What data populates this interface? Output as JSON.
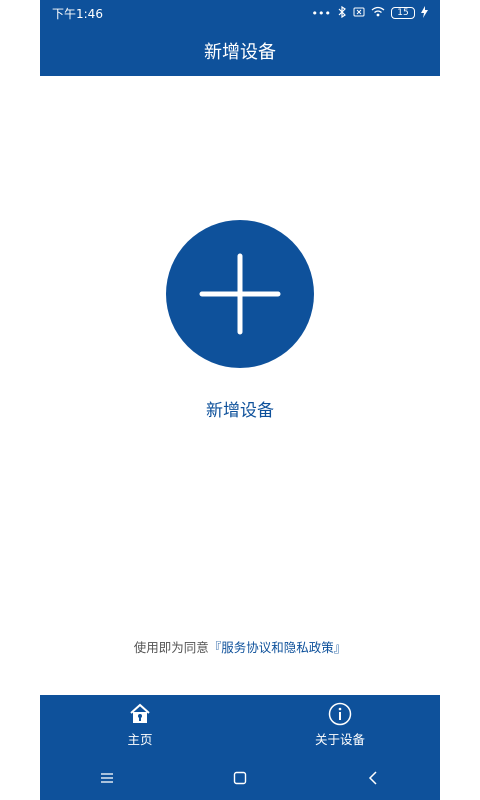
{
  "status_bar": {
    "time": "下午1:46",
    "battery": "15"
  },
  "app_bar": {
    "title": "新增设备"
  },
  "main": {
    "add_label": "新增设备"
  },
  "agreement": {
    "prefix": "使用即为同意",
    "link_text": "『服务协议和隐私政策』"
  },
  "bottom_nav": {
    "items": [
      {
        "label": "主页",
        "icon": "home-icon"
      },
      {
        "label": "关于设备",
        "icon": "info-icon"
      }
    ]
  },
  "colors": {
    "primary": "#0e519b",
    "background": "#ffffff",
    "text_muted": "#555555"
  }
}
